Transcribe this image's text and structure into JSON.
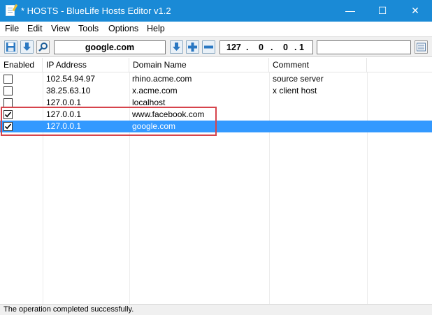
{
  "window": {
    "title": "* HOSTS - BlueLife Hosts Editor v1.2",
    "minimize_glyph": "—",
    "maximize_glyph": "☐",
    "close_glyph": "✕"
  },
  "menu": [
    "File",
    "Edit",
    "View",
    "Tools",
    "Options",
    "Help"
  ],
  "toolbar": {
    "icons": [
      "save-icon",
      "download-icon",
      "search-icon",
      "arrow-down-icon",
      "plus-icon",
      "minus-icon",
      "list-view-icon"
    ],
    "domain_value": "google.com",
    "ip_octets": [
      "127",
      "0",
      "0",
      "1"
    ],
    "ip_separator": ".",
    "comment_value": ""
  },
  "columns": [
    "Enabled",
    "IP Address",
    "Domain Name",
    "Comment"
  ],
  "rows": [
    {
      "enabled": false,
      "ip": "102.54.94.97",
      "domain": "rhino.acme.com",
      "comment": "source server",
      "selected": false
    },
    {
      "enabled": false,
      "ip": "38.25.63.10",
      "domain": "x.acme.com",
      "comment": "x client host",
      "selected": false
    },
    {
      "enabled": false,
      "ip": "127.0.0.1",
      "domain": "localhost",
      "comment": "",
      "selected": false
    },
    {
      "enabled": true,
      "ip": "127.0.0.1",
      "domain": "www.facebook.com",
      "comment": "",
      "selected": false
    },
    {
      "enabled": true,
      "ip": "127.0.0.1",
      "domain": "google.com",
      "comment": "",
      "selected": true
    }
  ],
  "status": "The operation completed successfully.",
  "colors": {
    "titlebar": "#1a8ad6",
    "selection": "#3399ff",
    "highlight_box": "#d6444b",
    "icon_blue": "#2a78c2"
  }
}
